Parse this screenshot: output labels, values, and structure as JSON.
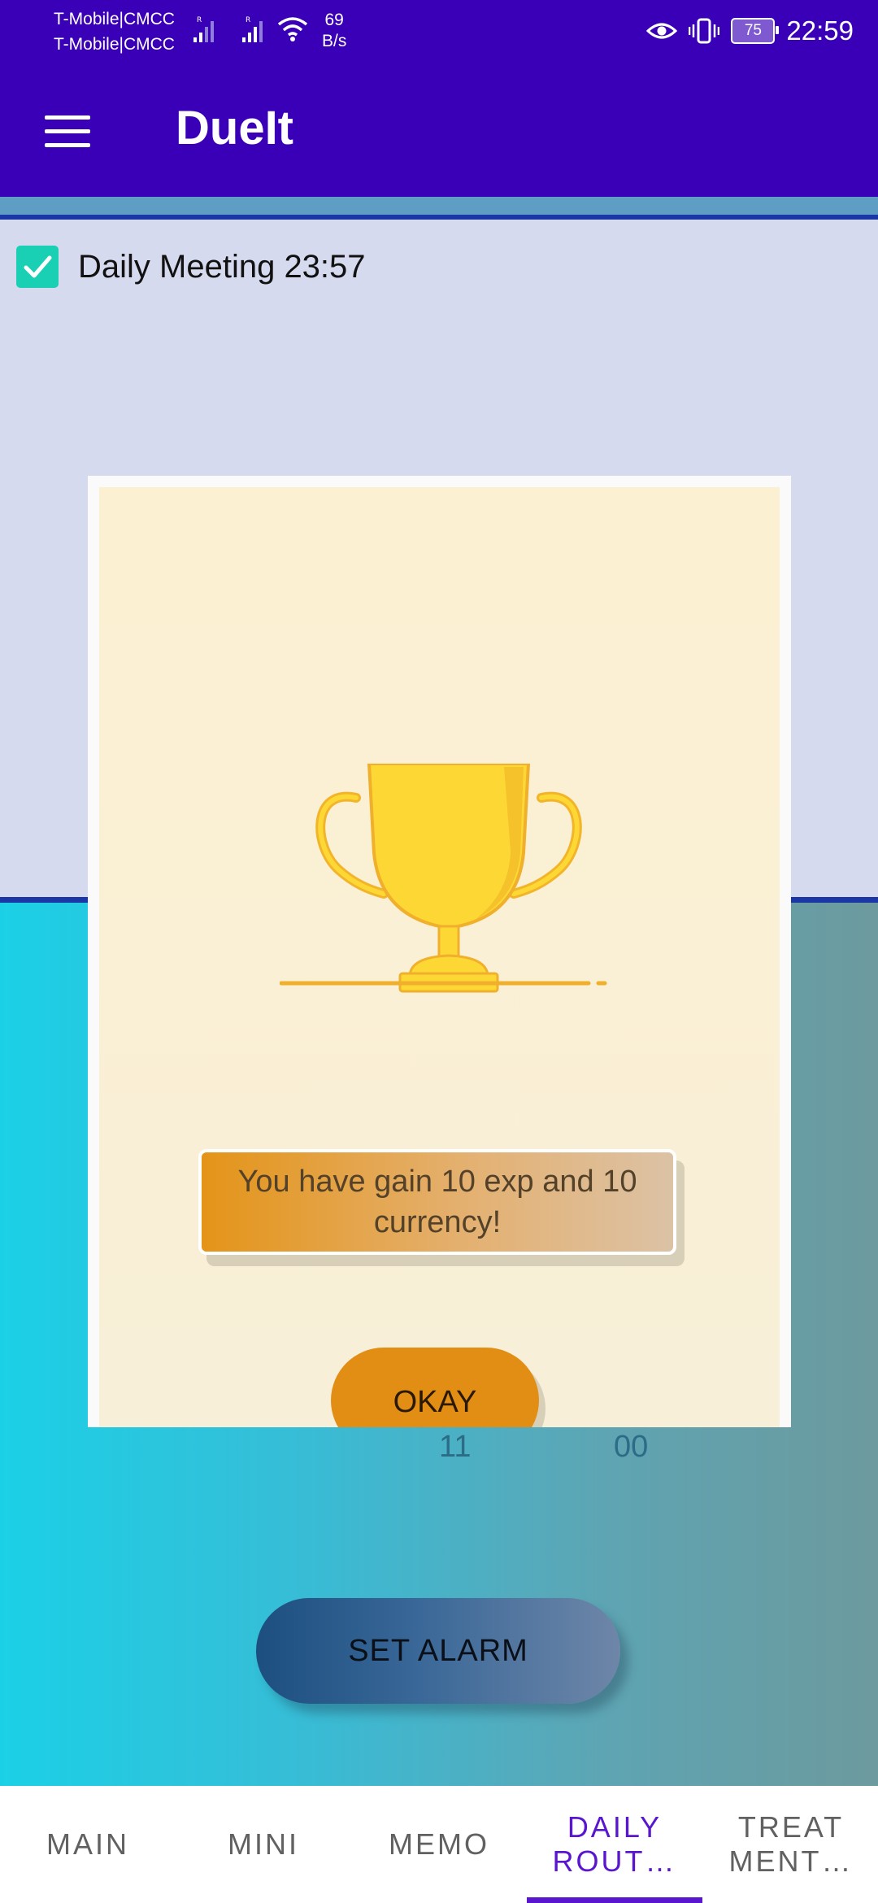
{
  "status_bar": {
    "carrier_1": "T-Mobile|CMCC",
    "carrier_2": "T-Mobile|CMCC",
    "net_speed_value": "69",
    "net_speed_unit": "B/s",
    "battery_level": "75",
    "time": "22:59",
    "icons": [
      "signal-icon",
      "wifi-icon",
      "eye-icon",
      "vibrate-icon",
      "battery-icon"
    ]
  },
  "app_bar": {
    "title": "DueIt",
    "menu_icon": "hamburger-menu-icon"
  },
  "routine": {
    "items": [
      {
        "label": "Daily Meeting 23:57",
        "checked": true
      }
    ]
  },
  "alarm_time": {
    "hour": "11",
    "minute": "00"
  },
  "set_alarm_label": "SET ALARM",
  "dialog": {
    "icon": "trophy-icon",
    "message": "You have gain 10 exp and 10 currency!",
    "okay_label": "OKAY"
  },
  "bottom_nav": {
    "tabs": [
      {
        "label": "MAIN",
        "active": false
      },
      {
        "label": "MINI",
        "active": false
      },
      {
        "label": "MEMO",
        "active": false
      },
      {
        "label": "DAILY ROUT…",
        "active": true
      },
      {
        "label": "TREAT MENT…",
        "active": false
      }
    ]
  },
  "colors": {
    "primary": "#3a00b7",
    "active_tab": "#5a16cf",
    "checkbox": "#19d0b5",
    "trophy": "#fdd835",
    "okay_button": "#e28e15"
  }
}
